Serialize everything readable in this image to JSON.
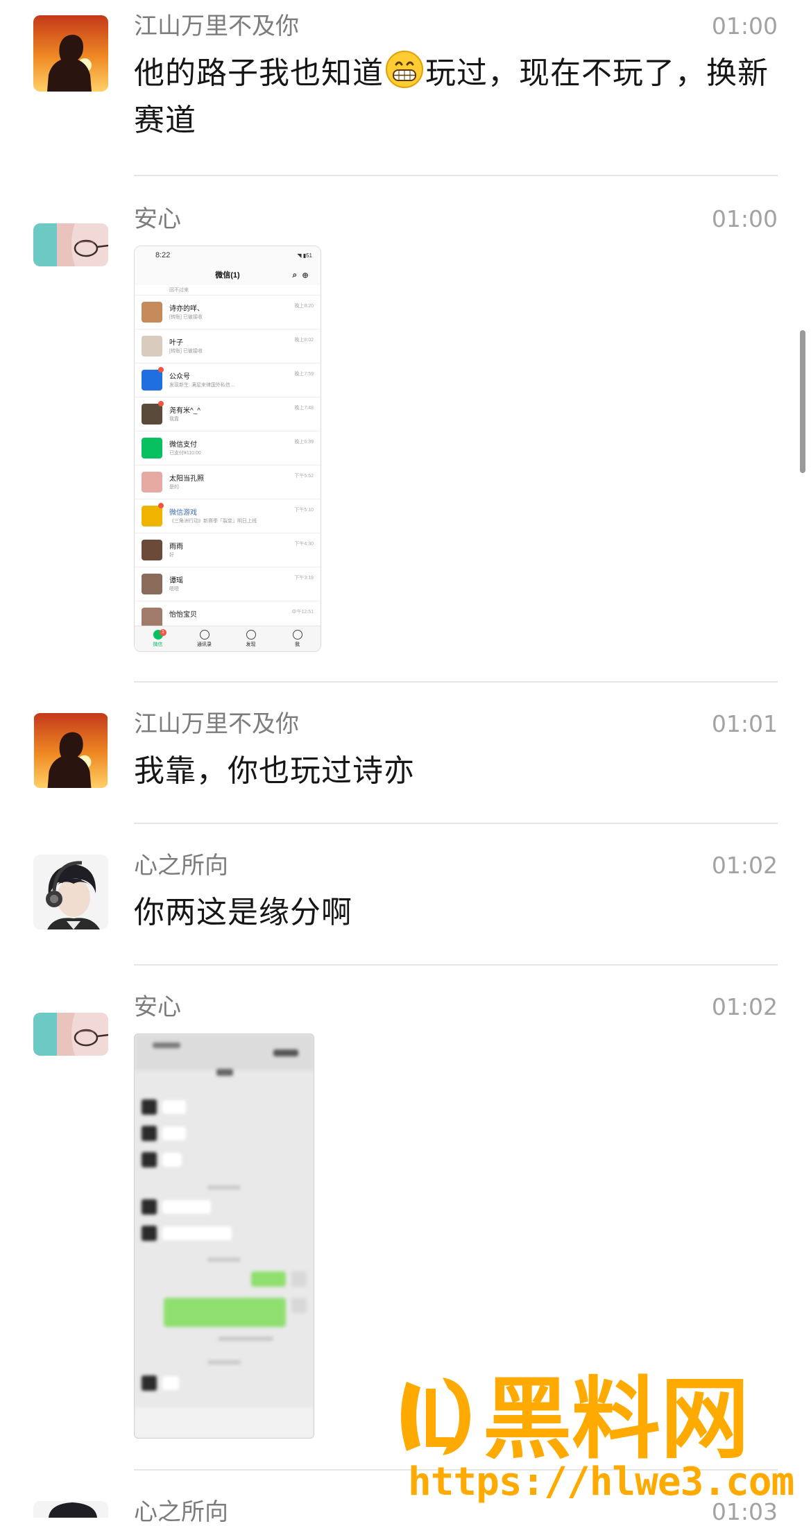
{
  "messages": [
    {
      "name": "江山万里不及你",
      "time": "01:00",
      "text_before": "他的路子我也知道",
      "emoji": "grinning-face-emoji",
      "text_after": "玩过，现在不玩了，换新赛道"
    },
    {
      "name": "安心",
      "time": "01:00"
    },
    {
      "name": "江山万里不及你",
      "time": "01:01",
      "text": "我靠，你也玩过诗亦"
    },
    {
      "name": "心之所向",
      "time": "01:02",
      "text": "你两这是缘分啊"
    },
    {
      "name": "安心",
      "time": "01:02"
    },
    {
      "name": "心之所向",
      "time": "01:03"
    }
  ],
  "screenshot1": {
    "status_time": "8:22",
    "battery": "51",
    "title": "微信(1)",
    "truncated_top_text": "回不过来",
    "chats": [
      {
        "name": "诗亦的咩、",
        "preview": "[转账] 已被接收",
        "time": "晚上8:20",
        "color": "#c58a5a"
      },
      {
        "name": "叶子",
        "preview": "[转账] 已被接收",
        "time": "晚上8:02",
        "color": "#d9cbbd"
      },
      {
        "name": "公众号",
        "preview": "发现新生: 满足来律国外私信…",
        "time": "晚上7:59",
        "color": "#1f6fe0"
      },
      {
        "name": "尧有米^_^",
        "preview": "我靠",
        "time": "晚上7:48",
        "color": "#5a4a3a"
      },
      {
        "name": "微信支付",
        "preview": "已支付¥110.00",
        "time": "晚上6:39",
        "color": "#07c160"
      },
      {
        "name": "太阳当孔照",
        "preview": "是的",
        "time": "下午5:52",
        "color": "#e7a9a4"
      },
      {
        "name": "微信游戏",
        "preview": "《三角洲行动》新赛季「裂变」明日上线",
        "time": "下午5:10",
        "color": "#f0b400"
      },
      {
        "name": "雨雨",
        "preview": "好",
        "time": "下午4:30",
        "color": "#6b4a3a"
      },
      {
        "name": "谭瑶",
        "preview": "嗯嗯",
        "time": "下午3:19",
        "color": "#8a6a5a"
      },
      {
        "name": "怡怡宝贝",
        "preview": "",
        "time": "中午12:51",
        "color": "#a07a6a"
      }
    ],
    "tabs": [
      "微信",
      "通讯录",
      "发现",
      "我"
    ],
    "tab_badge": "1"
  },
  "watermark": {
    "brand": "黑料网",
    "url": "https://hlwe3.com"
  },
  "colors": {
    "name": "#7c7c7c",
    "time": "#a2a2a2",
    "divider": "#e6e6e6",
    "wechat_green": "#07c160",
    "watermark": "#ffaa00"
  }
}
